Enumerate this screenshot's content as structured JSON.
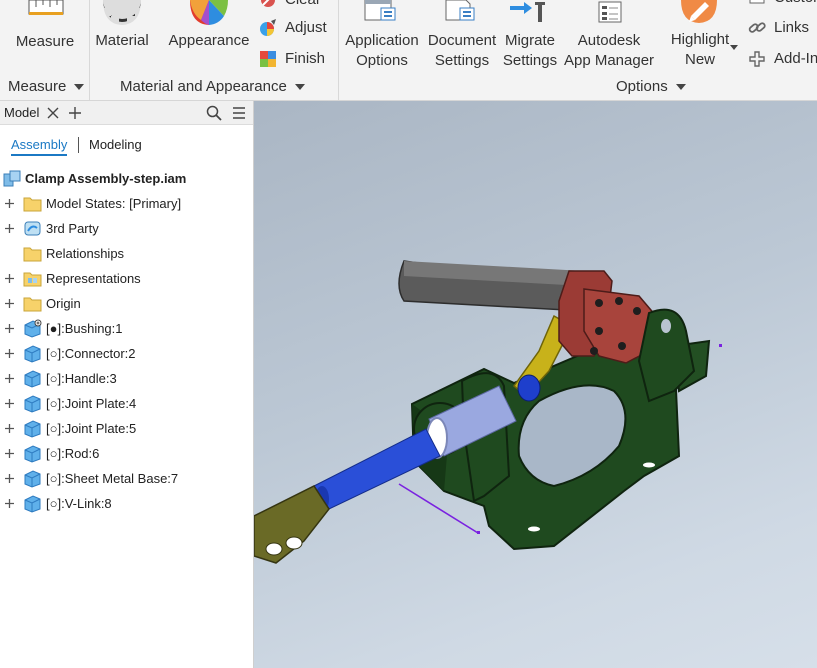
{
  "ribbon": {
    "measure_tool": "Measure",
    "material_tool": "Material",
    "appearance_tool": "Appearance",
    "clear_tool": "Clear",
    "adjust_tool": "Adjust",
    "finish_tool": "Finish",
    "app_options_line1": "Application",
    "app_options_line2": "Options",
    "doc_settings_line1": "Document",
    "doc_settings_line2": "Settings",
    "migrate_line1": "Migrate",
    "migrate_line2": "Settings",
    "app_manager_line1": "Autodesk",
    "app_manager_line2": "App Manager",
    "highlight_line1": "Highlight",
    "highlight_line2": "New",
    "customize_tool": "Customize",
    "links_tool": "Links",
    "addins_tool": "Add-Ins",
    "groups": {
      "measure": "Measure",
      "material_appearance": "Material and Appearance",
      "options": "Options"
    }
  },
  "panel": {
    "tab_label": "Model",
    "subtabs": [
      "Assembly",
      "Modeling"
    ],
    "active_subtab": "Assembly",
    "root": "Clamp Assembly-step.iam",
    "items": [
      {
        "label": "Model States: [Primary]",
        "icon": "folder-icon",
        "expandable": true
      },
      {
        "label": "3rd Party",
        "icon": "third-party-icon",
        "expandable": true
      },
      {
        "label": "Relationships",
        "icon": "folder-icon",
        "expandable": false
      },
      {
        "label": "Representations",
        "icon": "representations-icon",
        "expandable": true
      },
      {
        "label": "Origin",
        "icon": "folder-icon",
        "expandable": true
      },
      {
        "label": "[●]:Bushing:1",
        "icon": "part-grounded-icon",
        "expandable": true
      },
      {
        "label": "[○]:Connector:2",
        "icon": "part-icon",
        "expandable": true
      },
      {
        "label": "[○]:Handle:3",
        "icon": "part-icon",
        "expandable": true
      },
      {
        "label": "[○]:Joint Plate:4",
        "icon": "part-icon",
        "expandable": true
      },
      {
        "label": "[○]:Joint Plate:5",
        "icon": "part-icon",
        "expandable": true
      },
      {
        "label": "[○]:Rod:6",
        "icon": "part-icon",
        "expandable": true
      },
      {
        "label": "[○]:Sheet Metal Base:7",
        "icon": "part-icon",
        "expandable": true
      },
      {
        "label": "[○]:V-Link:8",
        "icon": "part-icon",
        "expandable": true
      }
    ]
  },
  "colors": {
    "accent": "#1b79c4",
    "base_green": "#1f4a1f",
    "rod_blue": "#2a4fd8",
    "link_yellow": "#c8b21a",
    "handle_gray": "#5b5b5b",
    "joint_red": "#9b3b35",
    "connector_olive": "#6a6a26"
  }
}
